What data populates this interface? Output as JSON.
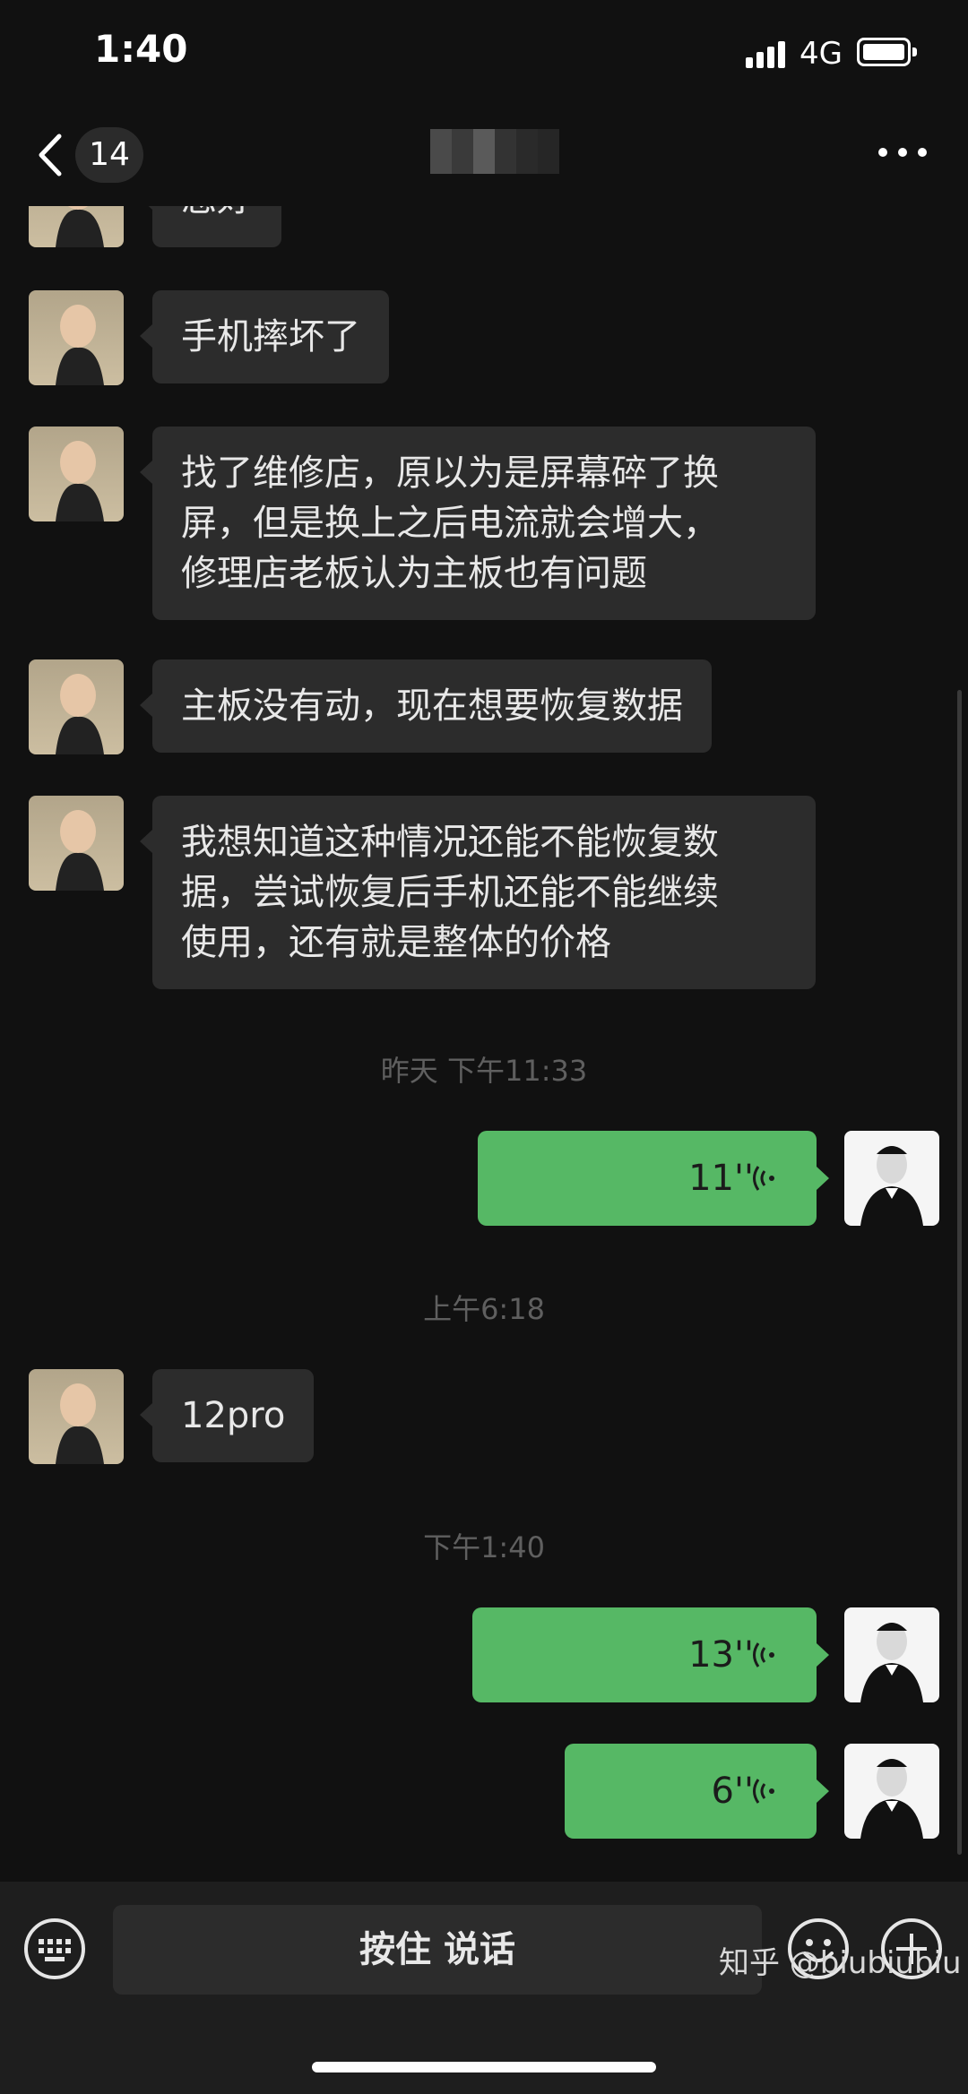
{
  "status": {
    "time": "1:40",
    "network": "4G"
  },
  "nav": {
    "unread": "14",
    "title_blurred": true
  },
  "messages": [
    {
      "side": "left",
      "type": "text",
      "text": "您好"
    },
    {
      "side": "left",
      "type": "text",
      "text": "手机摔坏了"
    },
    {
      "side": "left",
      "type": "text",
      "lines": [
        "找了维修店，原以为是屏幕碎了换",
        "屏，但是换上之后电流就会增大，",
        "修理店老板认为主板也有问题"
      ]
    },
    {
      "side": "left",
      "type": "text",
      "text": "主板没有动，现在想要恢复数据"
    },
    {
      "side": "left",
      "type": "text",
      "lines": [
        "我想知道这种情况还能不能恢复数",
        "据，尝试恢复后手机还能不能继续",
        "使用，还有就是整体的价格"
      ]
    },
    {
      "side": "center",
      "type": "timestamp",
      "text": "昨天 下午11:33"
    },
    {
      "side": "right",
      "type": "voice",
      "duration": "11''"
    },
    {
      "side": "center",
      "type": "timestamp",
      "text": "上午6:18"
    },
    {
      "side": "left",
      "type": "text",
      "text": "12pro"
    },
    {
      "side": "center",
      "type": "timestamp",
      "text": "下午1:40"
    },
    {
      "side": "right",
      "type": "voice",
      "duration": "13''"
    },
    {
      "side": "right",
      "type": "voice",
      "duration": "6''"
    }
  ],
  "input": {
    "hold_to_talk": "按住 说话"
  },
  "watermark": "知乎 @biubiubiu",
  "colors": {
    "background": "#111111",
    "bubble_left": "#2c2c2c",
    "bubble_voice": "#56b865",
    "timestamp": "#5f5f5f"
  },
  "icons": [
    "back-chevron-icon",
    "more-dots-icon",
    "keyboard-icon",
    "emoji-icon",
    "plus-icon",
    "voice-wave-icon"
  ]
}
